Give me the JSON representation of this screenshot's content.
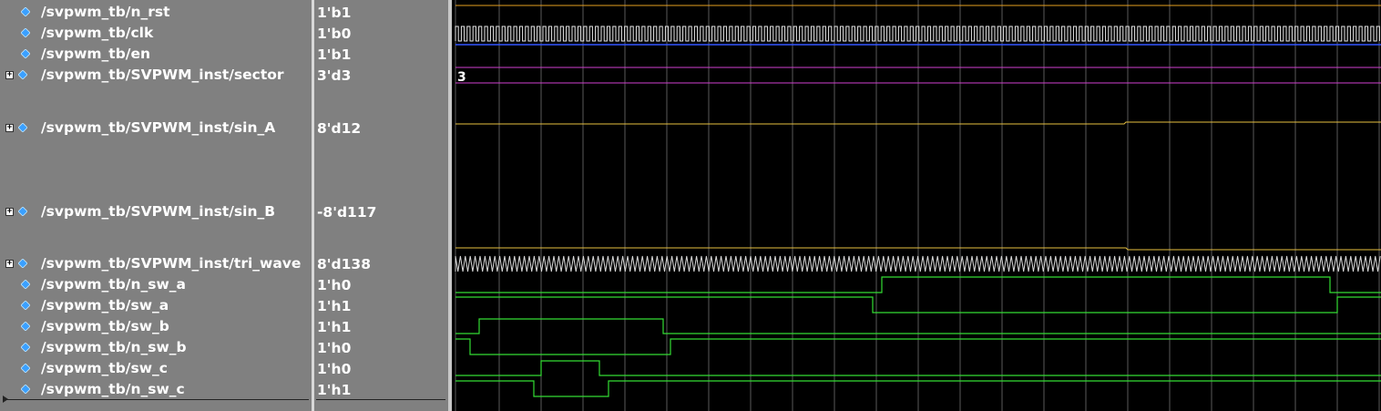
{
  "signals": [
    {
      "name": "/svpwm_tb/n_rst",
      "value": "1'b1",
      "expandable": false
    },
    {
      "name": "/svpwm_tb/clk",
      "value": "1'b0",
      "expandable": false
    },
    {
      "name": "/svpwm_tb/en",
      "value": "1'b1",
      "expandable": false
    },
    {
      "name": "/svpwm_tb/SVPWM_inst/sector",
      "value": "3'd3",
      "expandable": true
    },
    {
      "name": "/svpwm_tb/SVPWM_inst/sin_A",
      "value": "8'd12",
      "expandable": true
    },
    {
      "name": "/svpwm_tb/SVPWM_inst/sin_B",
      "value": "-8'd117",
      "expandable": true
    },
    {
      "name": "/svpwm_tb/SVPWM_inst/tri_wave",
      "value": "8'd138",
      "expandable": true
    },
    {
      "name": "/svpwm_tb/n_sw_a",
      "value": "1'h0",
      "expandable": false
    },
    {
      "name": "/svpwm_tb/sw_a",
      "value": "1'h1",
      "expandable": false
    },
    {
      "name": "/svpwm_tb/sw_b",
      "value": "1'h1",
      "expandable": false
    },
    {
      "name": "/svpwm_tb/n_sw_b",
      "value": "1'h0",
      "expandable": false
    },
    {
      "name": "/svpwm_tb/sw_c",
      "value": "1'h0",
      "expandable": false
    },
    {
      "name": "/svpwm_tb/n_sw_c",
      "value": "1'h1",
      "expandable": false
    }
  ],
  "bus_labels": {
    "sector": "3"
  },
  "colors": {
    "pane_bg": "#808080",
    "wave_bg": "#000000",
    "grid": "#5a5a5a",
    "digital": "#33dd33",
    "clk": "#e8e8e8",
    "n_rst": "#e6a020",
    "en": "#3355ff",
    "sector": "#d040d0",
    "analog": "#e6c040",
    "signal_icon": "#3aa0ff"
  },
  "icons": {
    "signal": "diamond-icon",
    "expand": "plus-box-icon"
  }
}
